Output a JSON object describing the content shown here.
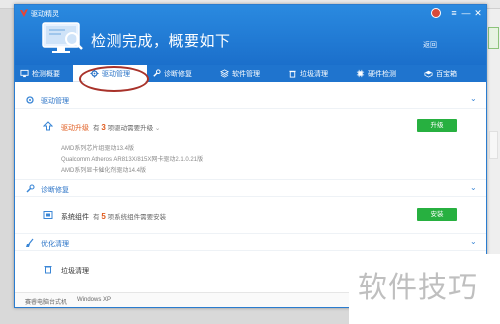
{
  "app": {
    "name": "驱动精灵",
    "headline": "检测完成，概要如下",
    "return_label": "返回"
  },
  "window_controls": [
    "≡",
    "—",
    "✕"
  ],
  "tabs": [
    {
      "label": "检测概要",
      "icon": "monitor-icon"
    },
    {
      "label": "驱动管理",
      "icon": "gear-icon"
    },
    {
      "label": "诊断修复",
      "icon": "wrench-icon"
    },
    {
      "label": "软件管理",
      "icon": "apps-icon"
    },
    {
      "label": "垃圾清理",
      "icon": "trash-icon"
    },
    {
      "label": "硬件检测",
      "icon": "chip-icon"
    },
    {
      "label": "百宝箱",
      "icon": "toolbox-icon"
    }
  ],
  "sections": {
    "driver": {
      "title": "驱动管理",
      "row_name": "驱动升级",
      "status_prefix": "有",
      "count": "3",
      "status_suffix": "项驱动需要升级",
      "button": "升级",
      "items": [
        "AMD系列芯片组驱动13.4版",
        "Qualcomm Atheros AR813X/815X网卡驱动2.1.0.21版",
        "AMD系列显卡催化剂驱动14.4版"
      ]
    },
    "diagnose": {
      "title": "诊断修复",
      "row_name": "系统组件",
      "status_prefix": "有",
      "count": "5",
      "status_suffix": "项系统组件需要安装",
      "button": "安装"
    },
    "cleanup": {
      "title": "优化清理",
      "row_name": "垃圾清理"
    }
  },
  "statusbar": {
    "left": "赛睿电脑台式机",
    "right": "Windows XP"
  },
  "watermark": "软件技巧",
  "colors": {
    "brand_blue": "#1f74ce",
    "accent_orange": "#e05a1c",
    "action_green": "#27b040"
  }
}
